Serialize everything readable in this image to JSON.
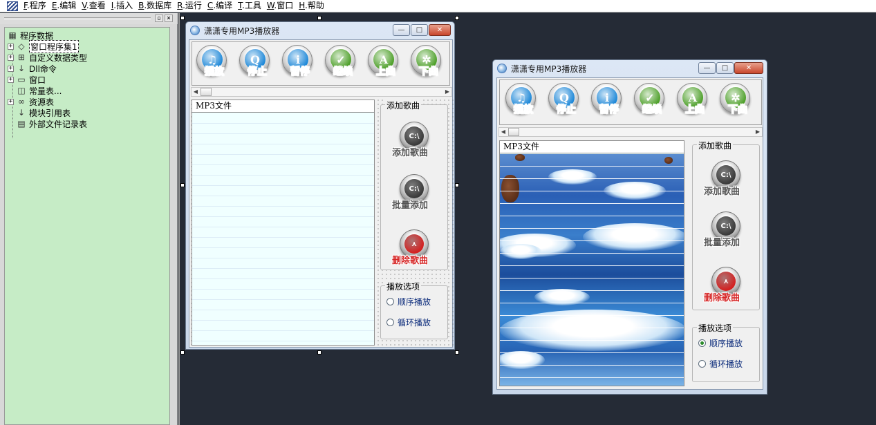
{
  "menu": [
    {
      "key": "F",
      "label": ".程序"
    },
    {
      "key": "E",
      "label": ".编辑"
    },
    {
      "key": "V",
      "label": ".查看"
    },
    {
      "key": "I",
      "label": ".插入"
    },
    {
      "key": "B",
      "label": ".数据库"
    },
    {
      "key": "R",
      "label": ".运行"
    },
    {
      "key": "C",
      "label": ".编译"
    },
    {
      "key": "T",
      "label": ".工具"
    },
    {
      "key": "W",
      "label": ".窗口"
    },
    {
      "key": "H",
      "label": ".帮助"
    }
  ],
  "panel": {
    "pin_glyph": "▫",
    "close_glyph": "×"
  },
  "tree": {
    "root": "程序数据",
    "items": [
      {
        "label": "窗口程序集1",
        "expander": "+",
        "icon": "◇"
      },
      {
        "label": "自定义数据类型",
        "expander": "+",
        "icon": "⊞"
      },
      {
        "label": "Dll命令",
        "expander": "+",
        "icon": "↓"
      },
      {
        "label": "窗口",
        "expander": "+",
        "icon": "▭"
      },
      {
        "label": "常量表...",
        "expander": "",
        "icon": "◫"
      },
      {
        "label": "资源表",
        "expander": "+",
        "icon": "∞"
      },
      {
        "label": "模块引用表",
        "expander": "",
        "icon": "↓"
      },
      {
        "label": "外部文件记录表",
        "expander": "",
        "icon": "▤"
      }
    ]
  },
  "player": {
    "title": "潇潇专用MP3播放器",
    "caption": {
      "min": "—",
      "max": "□",
      "close": "✕"
    },
    "toolbar": [
      {
        "label": "播放",
        "glyph": "♫",
        "color": "#1e88d8",
        "label_color": "#1a7ad0"
      },
      {
        "label": "停止",
        "glyph": "Q",
        "color": "#1e88d8",
        "label_color": "#1a7ad0"
      },
      {
        "label": "暂停",
        "glyph": "i",
        "color": "#1e88d8",
        "label_color": "#1a7ad0"
      },
      {
        "label": "继续",
        "glyph": "✓",
        "color": "#4ea02a",
        "label_color": "#2e8a1a"
      },
      {
        "label": "上曲",
        "glyph": "A",
        "color": "#4ea02a",
        "label_color": "#2e8a1a"
      },
      {
        "label": "下曲",
        "glyph": "✲",
        "color": "#4ea02a",
        "label_color": "#2e8a1a"
      }
    ],
    "list_header": "MP3文件",
    "add_group": {
      "title": "添加歌曲",
      "buttons": [
        {
          "label": "添加歌曲",
          "glyph": "C:\\",
          "color": "#3a3a3a",
          "danger": false
        },
        {
          "label": "批量添加",
          "glyph": "C:\\",
          "color": "#3a3a3a",
          "danger": false
        },
        {
          "label": "删除歌曲",
          "glyph": "⋏",
          "color": "#d42020",
          "danger": true
        }
      ]
    },
    "play_group": {
      "title": "播放选项",
      "options": [
        {
          "label": "顺序播放"
        },
        {
          "label": "循环播放"
        }
      ]
    },
    "scroll": {
      "left": "◀",
      "right": "▶"
    }
  },
  "runtime_state": {
    "selected_option": "顺序播放"
  }
}
